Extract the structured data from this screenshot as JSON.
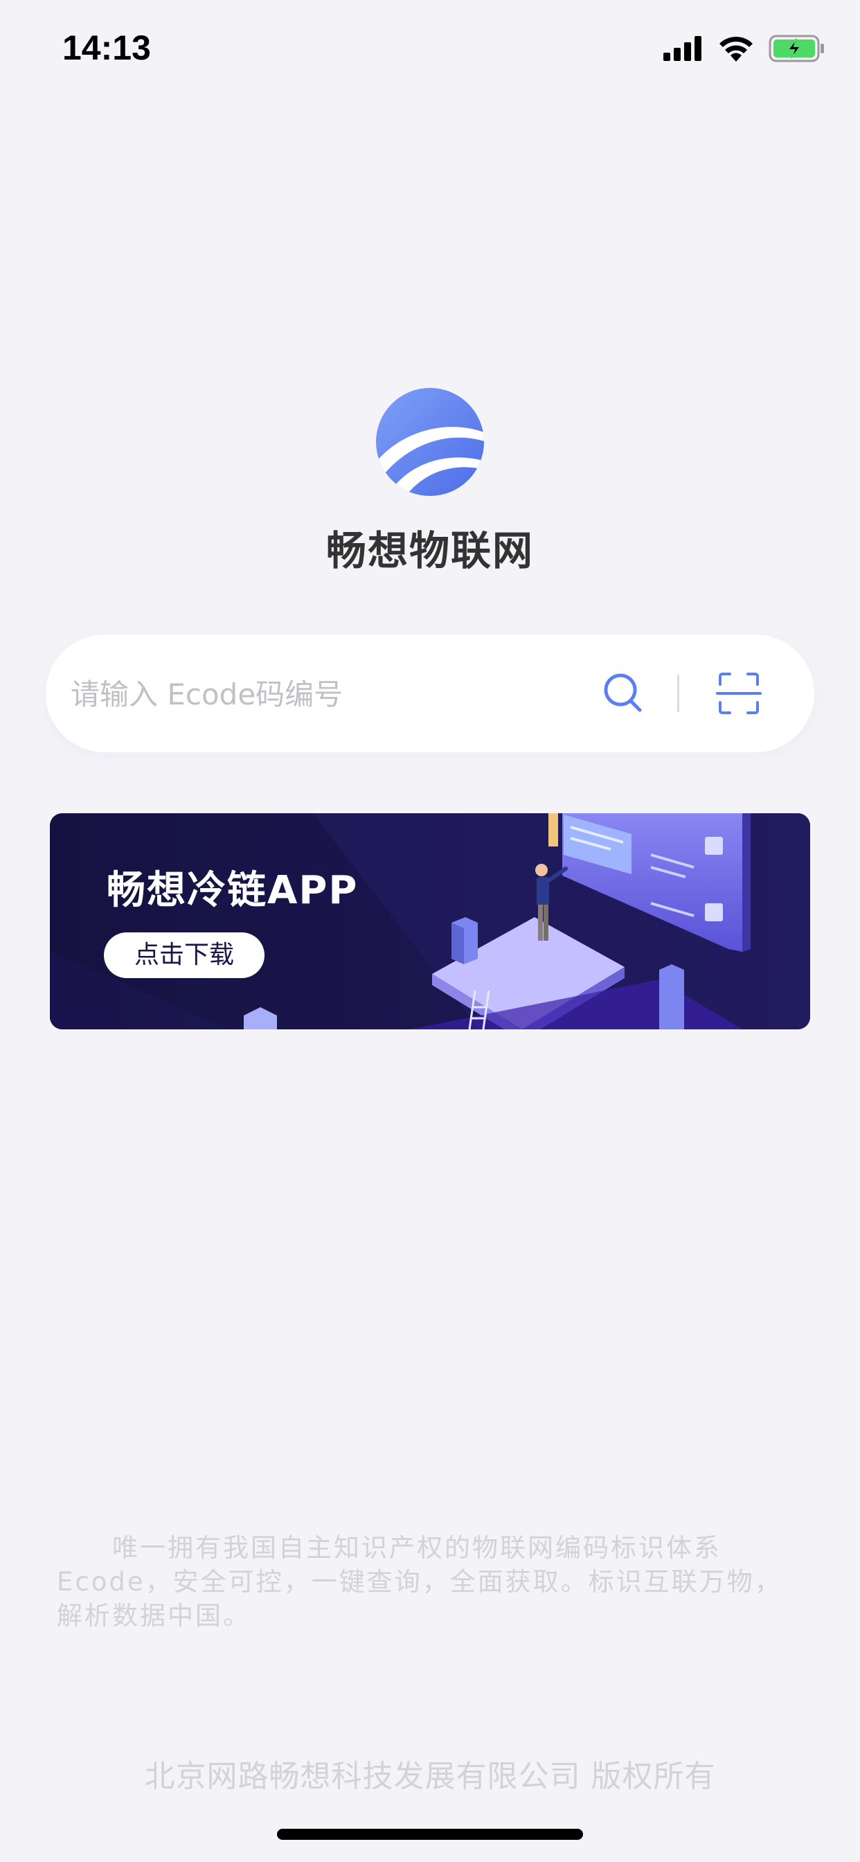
{
  "status_bar": {
    "time": "14:13",
    "icons": [
      "cellular-signal-icon",
      "wifi-icon",
      "battery-charging-icon"
    ]
  },
  "logo": {
    "name": "畅想物联网",
    "icon": "globe-logo-icon"
  },
  "search": {
    "placeholder": "请输入 Ecode码编号",
    "value": "",
    "search_icon": "search-icon",
    "scan_icon": "scan-icon"
  },
  "banner": {
    "title": "畅想冷链APP",
    "button_label": "点击下载"
  },
  "description": "唯一拥有我国自主知识产权的物联网编码标识体系Ecode，安全可控，一键查询，全面获取。标识互联万物，解析数据中国。",
  "footer": {
    "copyright": "北京网路畅想科技发展有限公司 版权所有"
  },
  "colors": {
    "accent": "#5b7ff0",
    "background": "#f4f4f8",
    "banner_bg": "#1a1648",
    "muted_text": "#d2d2d7"
  }
}
